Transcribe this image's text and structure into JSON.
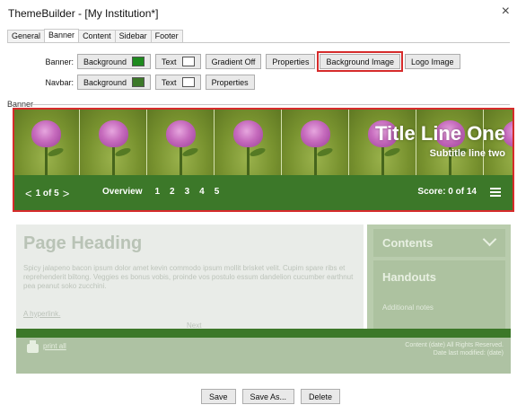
{
  "window": {
    "title": "ThemeBuilder - [My Institution*]",
    "close_glyph": "×"
  },
  "tabs": [
    "General",
    "Banner",
    "Content",
    "Sidebar",
    "Footer"
  ],
  "active_tab": "Banner",
  "banner_row": {
    "label": "Banner:",
    "background": {
      "label": "Background",
      "swatch": "#1e8a1e"
    },
    "text": {
      "label": "Text",
      "swatch": "#ffffff"
    },
    "gradient": "Gradient Off",
    "properties": "Properties",
    "background_image": "Background Image",
    "logo_image": "Logo Image"
  },
  "navbar_row": {
    "label": "Navbar:",
    "background": {
      "label": "Background",
      "swatch": "#3c7829"
    },
    "text": {
      "label": "Text",
      "swatch": "#ffffff"
    },
    "properties": "Properties"
  },
  "group_label": "Banner",
  "preview": {
    "banner": {
      "title": "Title Line One",
      "subtitle": "Subtitle line two"
    },
    "navbar": {
      "prev": "<",
      "pager": "1 of 5",
      "next": ">",
      "overview": "Overview",
      "pages": [
        "1",
        "2",
        "3",
        "4",
        "5"
      ],
      "score": "Score: 0 of 14"
    },
    "content": {
      "heading": "Page Heading",
      "body": "Spicy jalapeno bacon ipsum dolor amet kevin commodo ipsum mollit brisket velit. Cupim spare ribs et reprehenderit biltong. Veggies es bonus vobis, proinde vos postulo essum dandelion cucumber earthnut pea peanut soko zucchini.",
      "hyperlink": "A hyperlink.",
      "next": "Next"
    },
    "sidebar": {
      "contents": "Contents",
      "handouts": "Handouts",
      "notes": "Additional notes"
    },
    "footer": {
      "print": "print all",
      "copyright": "Content (date) All Rights Reserved.",
      "modified": "Date last modified: (date)"
    }
  },
  "buttons": {
    "save": "Save",
    "save_as": "Save As...",
    "delete": "Delete"
  },
  "colors": {
    "highlight": "#d62b2b",
    "navbar": "#3c7829"
  }
}
